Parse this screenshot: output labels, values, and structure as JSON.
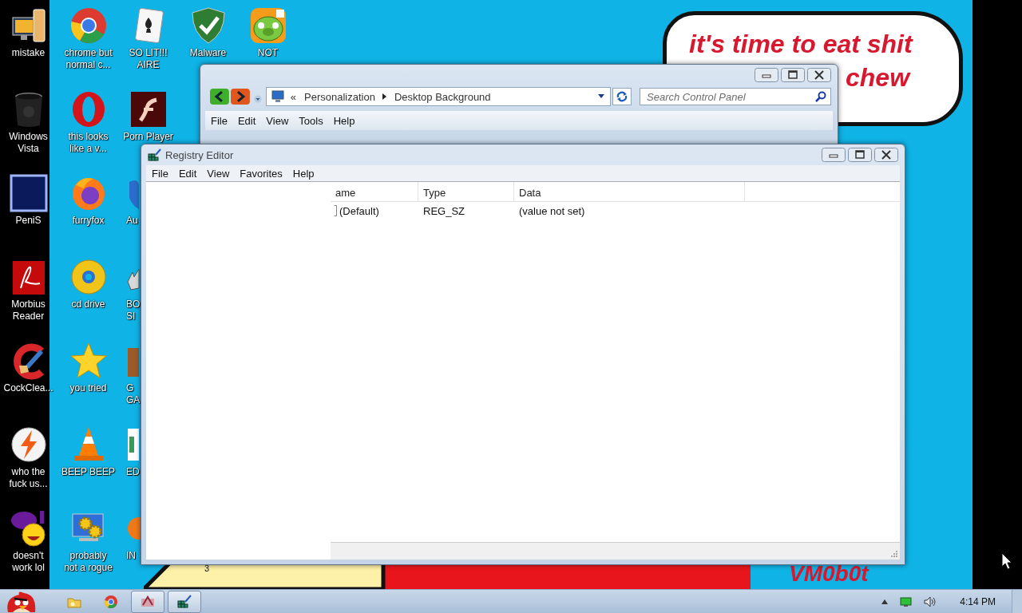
{
  "desktop": {
    "icon_columns": [
      [
        {
          "label": "mistake",
          "kind": "full"
        },
        {
          "label": "Windows\nVista",
          "kind": "full"
        },
        {
          "label": "PeniS",
          "kind": "full"
        },
        {
          "label": "Morbius\nReader",
          "kind": "full"
        },
        {
          "label": "CockClea...",
          "kind": "full"
        },
        {
          "label": "who the\nfuck us...",
          "kind": "full"
        },
        {
          "label": "doesn't\nwork lol",
          "kind": "full"
        }
      ],
      [
        {
          "label": "chrome but\nnormal c...",
          "kind": "full"
        },
        {
          "label": "this looks\nlike a v...",
          "kind": "full"
        },
        {
          "label": "furryfox",
          "kind": "full"
        },
        {
          "label": "cd drive",
          "kind": "full"
        },
        {
          "label": "you tried",
          "kind": "full"
        },
        {
          "label": "BEEP BEEP",
          "kind": "full"
        },
        {
          "label": "probably\nnot a rogue",
          "kind": "full"
        }
      ],
      [
        {
          "label": "SO LIT!!!\nAIRE",
          "kind": "full"
        },
        {
          "label": "Porn Player",
          "kind": "full"
        },
        {
          "label": "Au",
          "kind": "clipped"
        },
        {
          "label": "BO\nSI",
          "kind": "clipped"
        },
        {
          "label": "G\nGA",
          "kind": "clipped"
        },
        {
          "label": "ED",
          "kind": "clipped"
        },
        {
          "label": "IN",
          "kind": "clipped"
        }
      ],
      [
        {
          "label": "Malware",
          "kind": "full"
        }
      ],
      [
        {
          "label": "NOT",
          "kind": "full"
        }
      ]
    ],
    "wallpaper": {
      "bubble_lines": [
        "it's time to eat shit",
        "chew"
      ],
      "number": "3",
      "signature": "VM0b0t"
    }
  },
  "control_panel": {
    "breadcrumb_overflow": "«",
    "breadcrumb": [
      "Personalization",
      "Desktop Background"
    ],
    "search": {
      "placeholder": "Search Control Panel"
    },
    "menu": [
      "File",
      "Edit",
      "View",
      "Tools",
      "Help"
    ]
  },
  "registry_editor": {
    "title": "Registry Editor",
    "menu": [
      "File",
      "Edit",
      "View",
      "Favorites",
      "Help"
    ],
    "columns": [
      "ame",
      "Type",
      "Data"
    ],
    "rows": [
      {
        "cells": [
          "(Default)",
          "REG_SZ",
          "(value not set)"
        ]
      }
    ]
  },
  "taskbar": {
    "buttons": [
      {
        "open": false
      },
      {
        "open": false
      },
      {
        "open": true
      },
      {
        "open": true
      }
    ],
    "clock": "4:14 PM"
  }
}
